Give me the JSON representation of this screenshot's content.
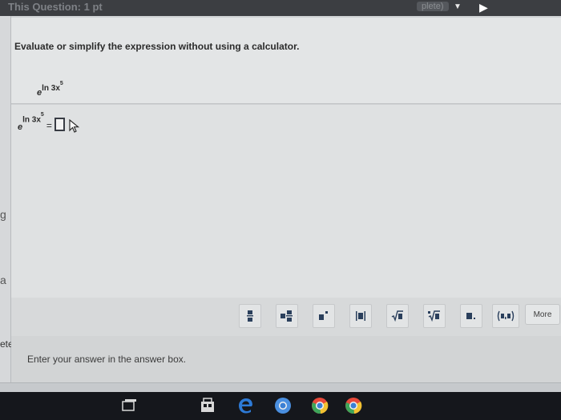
{
  "header": {
    "title": "This Question: 1 pt",
    "save_status": "plete)"
  },
  "question": {
    "instruction": "Evaluate or simplify the expression without using a calculator.",
    "expression": {
      "base": "e",
      "exponent": "ln 3x",
      "power": "5"
    }
  },
  "answer": {
    "base": "e",
    "exponent": "ln 3x",
    "power": "5",
    "equals": "="
  },
  "toolbar": {
    "buttons": [
      {
        "name": "fraction",
        "glyph": "▬"
      },
      {
        "name": "mixed-number",
        "glyph": "▪▬"
      },
      {
        "name": "exponent",
        "glyph": "▪'"
      },
      {
        "name": "absolute-value",
        "glyph": "|▪|"
      },
      {
        "name": "square-root",
        "glyph": "√▪"
      },
      {
        "name": "nth-root",
        "glyph": "∜▪"
      },
      {
        "name": "decimal",
        "glyph": "▪."
      },
      {
        "name": "ordered-pair",
        "glyph": "(▪,▪)"
      }
    ],
    "more_label": "More"
  },
  "hint": {
    "text": "Enter your answer in the answer box."
  },
  "left_edge": {
    "fragment_1": "g",
    "fragment_2": "a",
    "label": "ete"
  },
  "colors": {
    "header_bg": "#3c3e42",
    "panel_bg": "#e3e5e6",
    "taskbar_bg": "#15171c",
    "answer_box_border": "#383c44",
    "toolbar_icon": "#2a3f5c"
  },
  "taskbar": {
    "icons": [
      "task-view-icon",
      "store-icon",
      "edge-icon",
      "chrome-icon",
      "chrome-icon"
    ]
  }
}
